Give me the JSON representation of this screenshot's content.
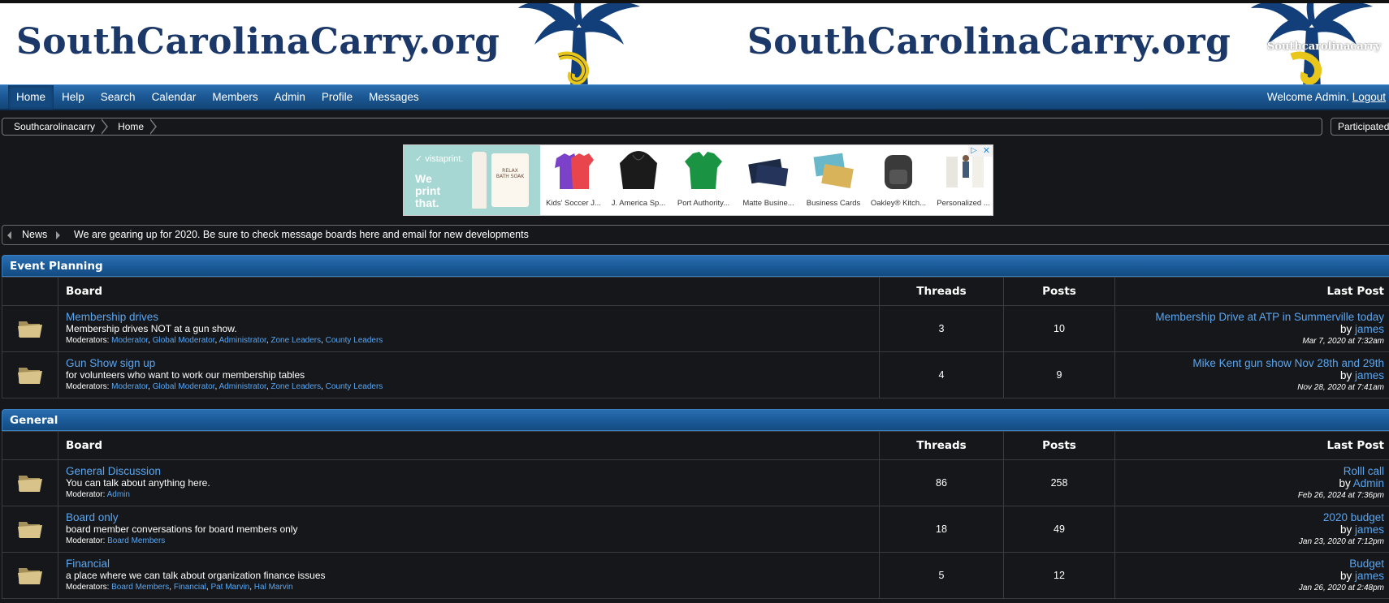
{
  "banner": {
    "title_left": "SouthCarolinaCarry.org",
    "title_right": "SouthCarolinaCarry.org",
    "small_title": "Southcarolinacarry"
  },
  "nav": {
    "items": [
      "Home",
      "Help",
      "Search",
      "Calendar",
      "Members",
      "Admin",
      "Profile",
      "Messages"
    ],
    "welcome": "Welcome Admin.",
    "logout": "Logout"
  },
  "breadcrumb": [
    "Southcarolinacarry",
    "Home"
  ],
  "participated": "Participated",
  "ad": {
    "brand": "vistaprint.",
    "slogan_lines": [
      "We",
      "print",
      "that."
    ],
    "package_text": "RELAX\nBATH SOAK",
    "products": [
      "Kids' Soccer J...",
      "J. America Sp...",
      "Port Authority...",
      "Matte Busine...",
      "Business Cards",
      "Oakley® Kitch...",
      "Personalized ..."
    ],
    "colors": {
      "background": "#a7d7d3"
    }
  },
  "news": {
    "label": "News",
    "text": "We are gearing up for 2020. Be sure to check message boards here and email for new developments"
  },
  "columns": {
    "board": "Board",
    "threads": "Threads",
    "posts": "Posts",
    "last_post": "Last Post"
  },
  "categories": [
    {
      "name": "Event Planning",
      "boards": [
        {
          "name": "Membership drives",
          "desc": "Membership drives NOT at a gun show.",
          "mod_label": "Moderators:",
          "mods": [
            "Moderator",
            "Global Moderator",
            "Administrator",
            "Zone Leaders",
            "County Leaders"
          ],
          "threads": "3",
          "posts": "10",
          "last_title": "Membership Drive at ATP in Summerville today",
          "by": "by",
          "last_user": "james",
          "last_date": "Mar 7, 2020 at 7:32am"
        },
        {
          "name": "Gun Show sign up",
          "desc": "for volunteers who want to work our membership tables",
          "mod_label": "Moderators:",
          "mods": [
            "Moderator",
            "Global Moderator",
            "Administrator",
            "Zone Leaders",
            "County Leaders"
          ],
          "threads": "4",
          "posts": "9",
          "last_title": "Mike Kent gun show Nov 28th and 29th",
          "by": "by",
          "last_user": "james",
          "last_date": "Nov 28, 2020 at 7:41am"
        }
      ]
    },
    {
      "name": "General",
      "boards": [
        {
          "name": "General Discussion",
          "desc": "You can talk about anything here.",
          "mod_label": "Moderator:",
          "mods": [
            "Admin"
          ],
          "threads": "86",
          "posts": "258",
          "last_title": "Rolll call",
          "by": "by",
          "last_user": "Admin",
          "last_date": "Feb 26, 2024 at 7:36pm"
        },
        {
          "name": "Board only",
          "desc": "board member conversations for board members only",
          "mod_label": "Moderator:",
          "mods": [
            "Board Members"
          ],
          "threads": "18",
          "posts": "49",
          "last_title": "2020 budget",
          "by": "by",
          "last_user": "james",
          "last_date": "Jan 23, 2020 at 7:12pm"
        },
        {
          "name": "Financial",
          "desc": "a place where we can talk about organization finance issues",
          "mod_label": "Moderators:",
          "mods": [
            "Board Members",
            "Financial",
            "Pat Marvin",
            "Hal Marvin"
          ],
          "threads": "5",
          "posts": "12",
          "last_title": "Budget",
          "by": "by",
          "last_user": "james",
          "last_date": "Jan 26, 2020 at 2:48pm"
        }
      ]
    }
  ],
  "colors": {
    "link": "#5aa6f0",
    "header_blue": "#1a5a98",
    "banner_navy": "#1b3868",
    "background": "#16171a"
  }
}
